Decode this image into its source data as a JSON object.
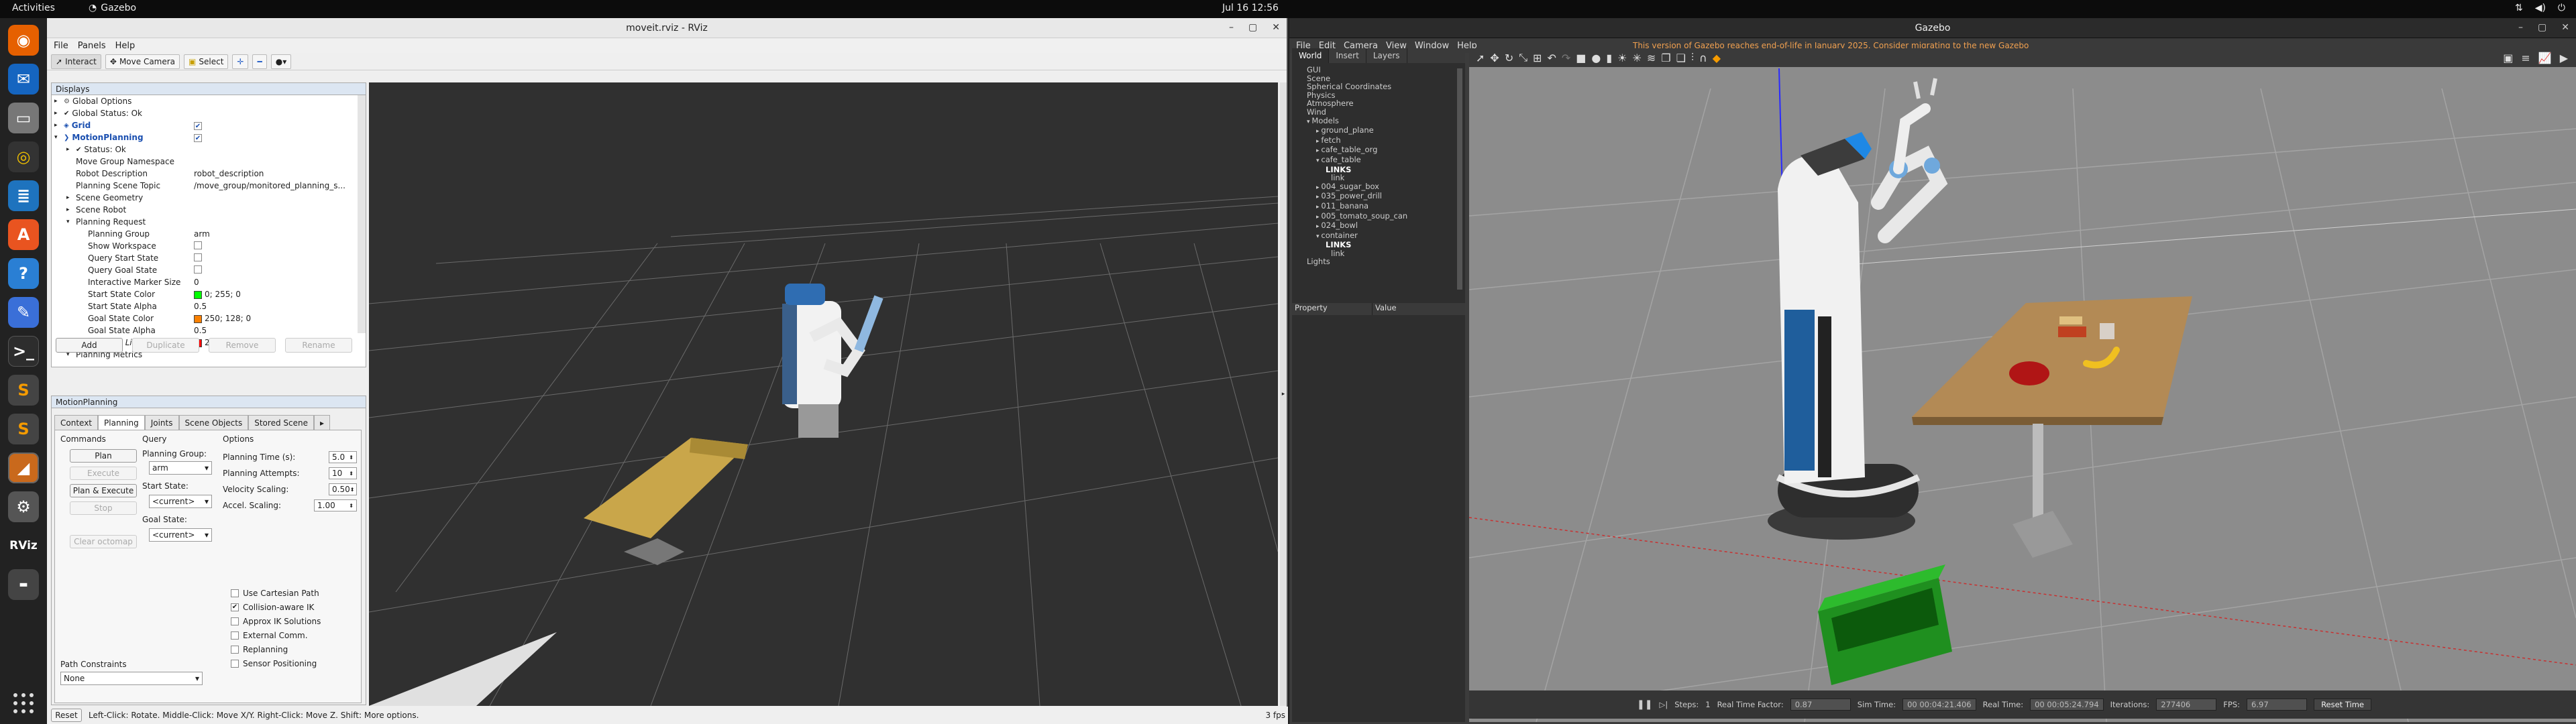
{
  "topbar": {
    "activities": "Activities",
    "app_name": "Gazebo",
    "clock": "Jul 16  12:56"
  },
  "rviz": {
    "title": "moveit.rviz - RViz",
    "menu": [
      "File",
      "Panels",
      "Help"
    ],
    "toolbar": {
      "interact": "Interact",
      "move_camera": "Move Camera",
      "select": "Select"
    },
    "displays": {
      "header": "Displays",
      "rows": [
        {
          "label": "Global Options",
          "value": ""
        },
        {
          "label": "Global Status: Ok",
          "value": ""
        },
        {
          "label": "Grid",
          "value": ""
        },
        {
          "label": "MotionPlanning",
          "value": ""
        },
        {
          "label": "Status: Ok",
          "value": ""
        },
        {
          "label": "Move Group Namespace",
          "value": ""
        },
        {
          "label": "Robot Description",
          "value": "robot_description"
        },
        {
          "label": "Planning Scene Topic",
          "value": "/move_group/monitored_planning_s..."
        },
        {
          "label": "Scene Geometry",
          "value": ""
        },
        {
          "label": "Scene Robot",
          "value": ""
        },
        {
          "label": "Planning Request",
          "value": ""
        },
        {
          "label": "Planning Group",
          "value": "arm"
        },
        {
          "label": "Show Workspace",
          "value": ""
        },
        {
          "label": "Query Start State",
          "value": ""
        },
        {
          "label": "Query Goal State",
          "value": ""
        },
        {
          "label": "Interactive Marker Size",
          "value": "0"
        },
        {
          "label": "Start State Color",
          "value": "0; 255; 0"
        },
        {
          "label": "Start State Alpha",
          "value": "0.5"
        },
        {
          "label": "Goal State Color",
          "value": "250; 128; 0"
        },
        {
          "label": "Goal State Alpha",
          "value": "0.5"
        },
        {
          "label": "Colliding Link Color",
          "value": "255; 0; 0"
        },
        {
          "label": "Planning Metrics",
          "value": ""
        }
      ],
      "buttons": [
        "Add",
        "Duplicate",
        "Remove",
        "Rename"
      ]
    },
    "motion": {
      "header": "MotionPlanning",
      "tabs": [
        "Context",
        "Planning",
        "Joints",
        "Scene Objects",
        "Stored Scene"
      ],
      "commands_label": "Commands",
      "commands": [
        "Plan",
        "Execute",
        "Plan & Execute",
        "Stop",
        "Clear octomap"
      ],
      "query_label": "Query",
      "planning_group_label": "Planning Group:",
      "planning_group": "arm",
      "start_state_label": "Start State:",
      "start_state": "<current>",
      "goal_state_label": "Goal State:",
      "goal_state": "<current>",
      "options_label": "Options",
      "options": [
        {
          "label": "Planning Time (s):",
          "value": "5.0"
        },
        {
          "label": "Planning Attempts:",
          "value": "10"
        },
        {
          "label": "Velocity Scaling:",
          "value": "0.50"
        },
        {
          "label": "Accel. Scaling:",
          "value": "1.00"
        }
      ],
      "checks": [
        {
          "label": "Use Cartesian Path",
          "checked": false
        },
        {
          "label": "Collision-aware IK",
          "checked": true
        },
        {
          "label": "Approx IK Solutions",
          "checked": false
        },
        {
          "label": "External Comm.",
          "checked": false
        },
        {
          "label": "Replanning",
          "checked": false
        },
        {
          "label": "Sensor Positioning",
          "checked": false
        }
      ],
      "path_constraints_label": "Path Constraints",
      "path_constraints": "None"
    },
    "status": {
      "reset": "Reset",
      "hint": "Left-Click: Rotate. Middle-Click: Move X/Y. Right-Click: Move Z. Shift: More options.",
      "fps": "3 fps"
    }
  },
  "gazebo": {
    "title": "Gazebo",
    "menu": [
      "File",
      "Edit",
      "Camera",
      "View",
      "Window",
      "Help"
    ],
    "warning_prefix": "This version of Gazebo reaches end-of-life in January 2025. Consider ",
    "warning_link": "migrating to the new Gazebo",
    "left_tabs": [
      "World",
      "Insert",
      "Layers"
    ],
    "tree": [
      "GUI",
      "Scene",
      "Spherical Coordinates",
      "Physics",
      "Atmosphere",
      "Wind",
      "Models",
      "ground_plane",
      "fetch",
      "cafe_table_org",
      "cafe_table",
      "LINKS",
      "link",
      "004_sugar_box",
      "035_power_drill",
      "011_banana",
      "005_tomato_soup_can",
      "024_bowl",
      "container",
      "LINKS",
      "link",
      "Lights"
    ],
    "prop_headers": [
      "Property",
      "Value"
    ],
    "bottom": {
      "steps_label": "Steps:",
      "steps": "1",
      "rtf_label": "Real Time Factor:",
      "rtf": "0.87",
      "sim_label": "Sim Time:",
      "sim": "00 00:04:21.406",
      "real_label": "Real Time:",
      "real": "00 00:05:24.794",
      "iter_label": "Iterations:",
      "iter": "277406",
      "fps_label": "FPS:",
      "fps": "6.97",
      "reset": "Reset Time"
    },
    "colors": {
      "warning": "#f0a050",
      "container": "#1f8f1f"
    }
  }
}
